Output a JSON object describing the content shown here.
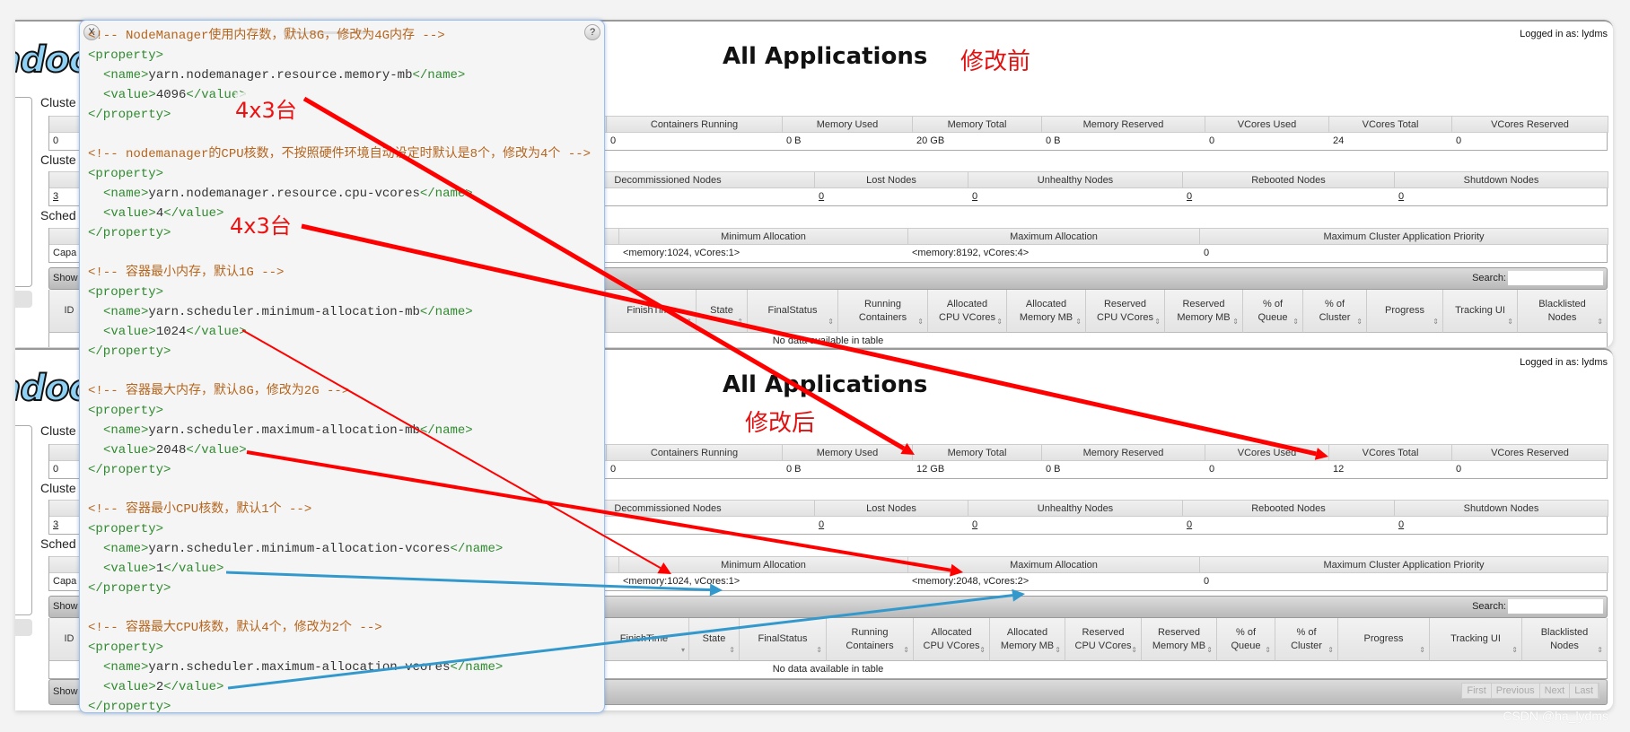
{
  "panels": [
    {
      "logo": "hadoop",
      "logged_in": "Logged in as: lydms",
      "title": "All Applications",
      "annotation": "修改前",
      "cluster_label": "Cluste",
      "nodes_label": "Cluste",
      "sched_label": "Sched",
      "metrics": {
        "headers": [
          "",
          "Containers Running",
          "Memory Used",
          "Memory Total",
          "Memory Reserved",
          "VCores Used",
          "VCores Total",
          "VCores Reserved"
        ],
        "values": [
          "0",
          "0",
          "0 B",
          "20 GB",
          "0 B",
          "0",
          "24",
          "0"
        ]
      },
      "nodes": {
        "headers": [
          "",
          "Decommissioned Nodes",
          "Lost Nodes",
          "Unhealthy Nodes",
          "Rebooted Nodes",
          "Shutdown Nodes"
        ],
        "values": [
          "3",
          "",
          "0",
          "0",
          "0",
          "0"
        ]
      },
      "scheduler": {
        "headers": [
          "",
          "Minimum Allocation",
          "Maximum Allocation",
          "Maximum Cluster Application Priority"
        ],
        "values": [
          "Capa",
          "<memory:1024, vCores:1>",
          "<memory:8192, vCores:4>",
          "0"
        ]
      },
      "show_label": "Show",
      "search_label": "Search:",
      "search_value": "",
      "apps_headers": [
        "ID",
        "",
        "FinishTime",
        "State",
        "FinalStatus",
        "Running\nContainers",
        "Allocated\nCPU VCores",
        "Allocated\nMemory MB",
        "Reserved\nCPU VCores",
        "Reserved\nMemory MB",
        "% of\nQueue",
        "% of\nCluster",
        "Progress",
        "Tracking UI",
        "Blacklisted\nNodes"
      ],
      "no_data": "No data available in table"
    },
    {
      "logo": "hadoop",
      "logged_in": "Logged in as: lydms",
      "title": "All Applications",
      "annotation": "修改后",
      "cluster_label": "Cluste",
      "nodes_label": "Cluste",
      "sched_label": "Sched",
      "metrics": {
        "headers": [
          "",
          "Containers Running",
          "Memory Used",
          "Memory Total",
          "Memory Reserved",
          "VCores Used",
          "VCores Total",
          "VCores Reserved"
        ],
        "values": [
          "0",
          "0",
          "0 B",
          "12 GB",
          "0 B",
          "0",
          "12",
          "0"
        ]
      },
      "nodes": {
        "headers": [
          "",
          "Decommissioned Nodes",
          "Lost Nodes",
          "Unhealthy Nodes",
          "Rebooted Nodes",
          "Shutdown Nodes"
        ],
        "values": [
          "3",
          "",
          "0",
          "0",
          "0",
          "0"
        ]
      },
      "scheduler": {
        "headers": [
          "",
          "Minimum Allocation",
          "Maximum Allocation",
          "Maximum Cluster Application Priority"
        ],
        "values": [
          "Capa",
          "<memory:1024, vCores:1>",
          "<memory:2048, vCores:2>",
          "0"
        ]
      },
      "show_label": "Show",
      "search_label": "Search:",
      "search_value": "",
      "apps_headers": [
        "ID",
        "",
        "FinishTime",
        "State",
        "FinalStatus",
        "Running\nContainers",
        "Allocated\nCPU VCores",
        "Allocated\nMemory MB",
        "Reserved\nCPU VCores",
        "Reserved\nMemory MB",
        "% of\nQueue",
        "% of\nCluster",
        "Progress",
        "Tracking UI",
        "Blacklisted\nNodes"
      ],
      "no_data": "No data available in table",
      "footer_show_label": "Show",
      "pager": [
        "First",
        "Previous",
        "Next",
        "Last"
      ]
    }
  ],
  "popup": {
    "close_label": "X",
    "help_label": "?",
    "lines": [
      {
        "t": "com",
        "text": "<!-- NodeManager使用内存数，默认8G，修改为4G内存 -->"
      },
      {
        "t": "tag",
        "text": "<property>"
      },
      {
        "t": "kv",
        "indent": true,
        "open": "<name>",
        "body": "yarn.nodemanager.resource.memory-mb",
        "close": "</name>"
      },
      {
        "t": "kv",
        "indent": true,
        "open": "<value>",
        "body": "4096",
        "close": "</value>"
      },
      {
        "t": "tag",
        "text": "</property>"
      },
      {
        "t": "blank"
      },
      {
        "t": "com",
        "text": "<!-- nodemanager的CPU核数，不按照硬件环境自动设定时默认是8个，修改为4个 -->"
      },
      {
        "t": "tag",
        "text": "<property>"
      },
      {
        "t": "kv",
        "indent": true,
        "open": "<name>",
        "body": "yarn.nodemanager.resource.cpu-vcores",
        "close": "</name>"
      },
      {
        "t": "kv",
        "indent": true,
        "open": "<value>",
        "body": "4",
        "close": "</value>"
      },
      {
        "t": "tag",
        "text": "</property>"
      },
      {
        "t": "blank"
      },
      {
        "t": "com",
        "text": "<!-- 容器最小内存，默认1G -->"
      },
      {
        "t": "tag",
        "text": "<property>"
      },
      {
        "t": "kv",
        "indent": true,
        "open": "<name>",
        "body": "yarn.scheduler.minimum-allocation-mb",
        "close": "</name>"
      },
      {
        "t": "kv",
        "indent": true,
        "open": "<value>",
        "body": "1024",
        "close": "</value>"
      },
      {
        "t": "tag",
        "text": "</property>"
      },
      {
        "t": "blank"
      },
      {
        "t": "com",
        "text": "<!-- 容器最大内存，默认8G，修改为2G -->"
      },
      {
        "t": "tag",
        "text": "<property>"
      },
      {
        "t": "kv",
        "indent": true,
        "open": "<name>",
        "body": "yarn.scheduler.maximum-allocation-mb",
        "close": "</name>"
      },
      {
        "t": "kv",
        "indent": true,
        "open": "<value>",
        "body": "2048",
        "close": "</value>"
      },
      {
        "t": "tag",
        "text": "</property>"
      },
      {
        "t": "blank"
      },
      {
        "t": "com",
        "text": "<!-- 容器最小CPU核数，默认1个 -->"
      },
      {
        "t": "tag",
        "text": "<property>"
      },
      {
        "t": "kv",
        "indent": true,
        "open": "<name>",
        "body": "yarn.scheduler.minimum-allocation-vcores",
        "close": "</name>"
      },
      {
        "t": "kv",
        "indent": true,
        "open": "<value>",
        "body": "1",
        "close": "</value>"
      },
      {
        "t": "tag",
        "text": "</property>"
      },
      {
        "t": "blank"
      },
      {
        "t": "com",
        "text": "<!-- 容器最大CPU核数，默认4个，修改为2个 -->"
      },
      {
        "t": "tag",
        "text": "<property>"
      },
      {
        "t": "kv",
        "indent": true,
        "open": "<name>",
        "body": "yarn.scheduler.maximum-allocation-vcores",
        "close": "</name>"
      },
      {
        "t": "kv",
        "indent": true,
        "open": "<value>",
        "body": "2",
        "close": "</value>"
      },
      {
        "t": "tag",
        "text": "</property>"
      }
    ]
  },
  "annotations": {
    "memory_nodes": "4x3台",
    "vcores_nodes": "4x3台"
  },
  "colors": {
    "arrow_red": "#ff0000",
    "arrow_blue": "#3399cc",
    "annotation_red": "#ee1111"
  },
  "watermark": "CSDN @ha_lydms"
}
